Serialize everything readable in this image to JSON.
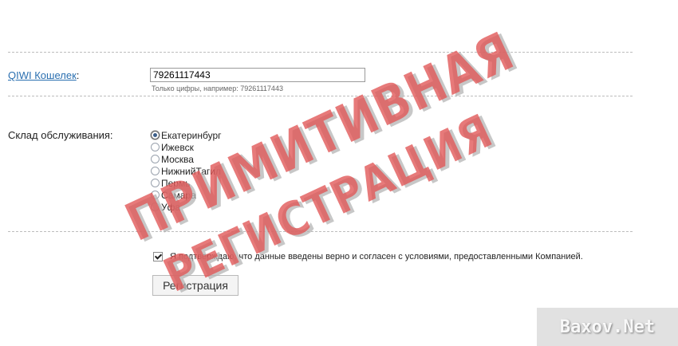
{
  "form": {
    "qiwi": {
      "label": "QIWI Кошелек",
      "label_suffix": ":",
      "value": "79261117443",
      "hint": "Только цифры, например: 79261117443"
    },
    "warehouse": {
      "label": "Склад обслуживания:",
      "options": [
        "Екатеринбург",
        "Ижевск",
        "Москва",
        "НижнийТагил",
        "Пермь",
        "Самара",
        "Уфа"
      ],
      "selected": "Екатеринбург"
    },
    "agree": {
      "checked": true,
      "text": "Я подтверждаю, что данные введены верно и согласен с условиями, предоставленными Компанией."
    },
    "submit_label": "Регистрация"
  },
  "stamp": {
    "line1": "ПРИМИТИВНАЯ",
    "line2": "РЕГИСТРАЦИЯ",
    "color": "#e05555"
  },
  "watermark": "Baxov.Net"
}
